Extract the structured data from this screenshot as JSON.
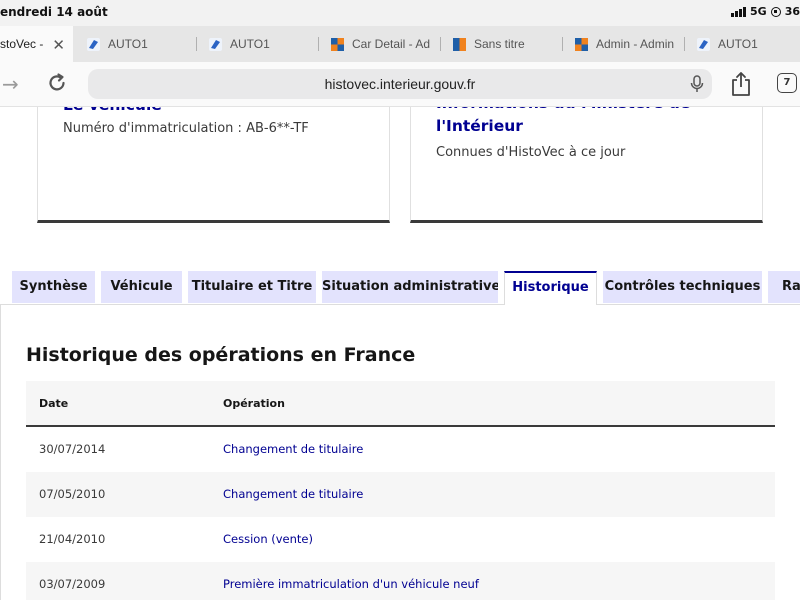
{
  "status_bar": {
    "time": "endredi 14 août",
    "network": "5G",
    "battery": "36"
  },
  "browser_tabs": [
    {
      "label": "stoVec -",
      "active": true
    },
    {
      "label": "AUTO1"
    },
    {
      "label": "AUTO1"
    },
    {
      "label": "Car Detail - Ad"
    },
    {
      "label": "Sans titre"
    },
    {
      "label": "Admin - Admin"
    },
    {
      "label": "AUTO1"
    }
  ],
  "address_bar": {
    "url": "histovec.interieur.gouv.fr",
    "tab_count": "7"
  },
  "cards": {
    "left": {
      "title": "Le véhicule",
      "desc": "Numéro d'immatriculation : AB-6**-TF"
    },
    "right": {
      "title_line1": "Informations du Ministère de",
      "title_line2": "l'Intérieur",
      "desc": "Connues d'HistoVec à ce jour"
    }
  },
  "page_tabs": [
    {
      "label": "Synthèse"
    },
    {
      "label": "Véhicule"
    },
    {
      "label": "Titulaire et Titre"
    },
    {
      "label": "Situation administrative"
    },
    {
      "label": "Historique",
      "selected": true
    },
    {
      "label": "Contrôles techniques"
    },
    {
      "label": "Rap"
    }
  ],
  "history": {
    "title": "Historique des opérations en France",
    "columns": [
      "Date",
      "Opération"
    ],
    "rows": [
      {
        "date": "30/07/2014",
        "operation": "Changement de titulaire"
      },
      {
        "date": "07/05/2010",
        "operation": "Changement de titulaire"
      },
      {
        "date": "21/04/2010",
        "operation": "Cession (vente)"
      },
      {
        "date": "03/07/2009",
        "operation": "Première immatriculation d'un véhicule neuf"
      }
    ]
  },
  "colors": {
    "accent": "#000091",
    "tab_bg": "#e3e3fd",
    "row_alt": "#f6f6f6"
  }
}
